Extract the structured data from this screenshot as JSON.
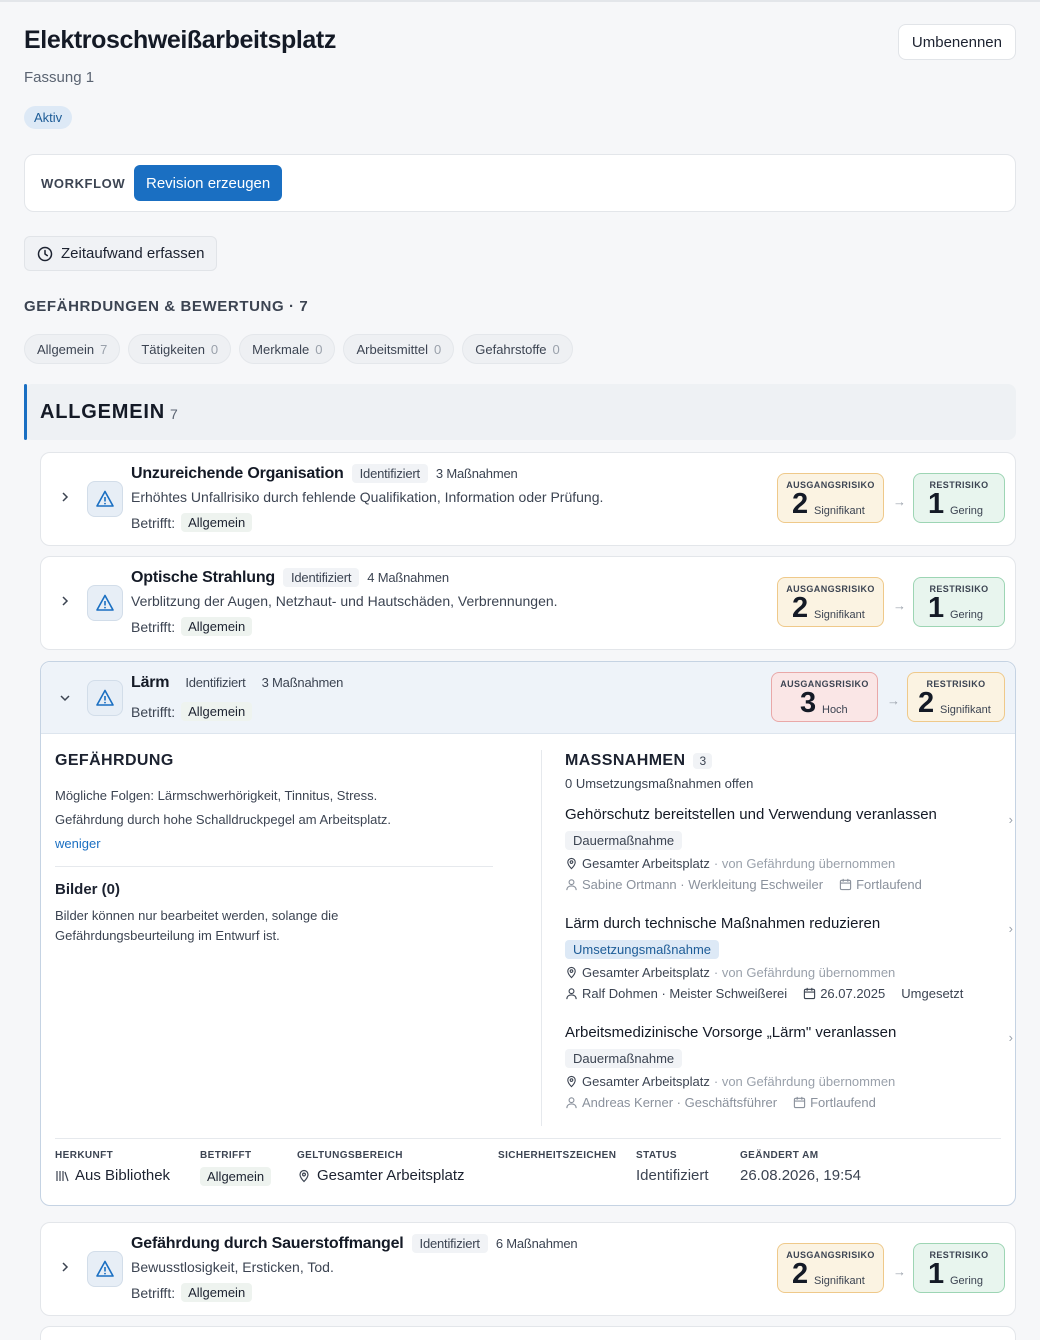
{
  "header": {
    "title": "Elektroschweißarbeitsplatz",
    "subtitle": "Fassung 1",
    "rename_label": "Umbenennen",
    "status": "Aktiv"
  },
  "workflow": {
    "label": "WORKFLOW",
    "button_label": "Revision erzeugen"
  },
  "time_button_label": "Zeitaufwand erfassen",
  "section_heading": "GEFÄHRDUNGEN & BEWERTUNG · 7",
  "filters": [
    {
      "label": "Allgemein",
      "count": "7"
    },
    {
      "label": "Tätigkeiten",
      "count": "0"
    },
    {
      "label": "Merkmale",
      "count": "0"
    },
    {
      "label": "Arbeitsmittel",
      "count": "0"
    },
    {
      "label": "Gefahrstoffe",
      "count": "0"
    }
  ],
  "group": {
    "title": "ALLGEMEIN",
    "count": "7"
  },
  "risk_labels": {
    "initial": "AUSGANGSRISIKO",
    "residual": "RESTRISIKO"
  },
  "affected_label": "Betrifft:",
  "hazards": [
    {
      "title": "Unzureichende Organisation",
      "state": "Identifiziert",
      "measures": "3 Maßnahmen",
      "description": "Erhöhtes Unfallrisiko durch fehlende Qualifikation, Information oder Prüfung.",
      "affected": "Allgemein",
      "initial_risk": {
        "value": "2",
        "label": "Signifikant"
      },
      "residual_risk": {
        "value": "1",
        "label": "Gering"
      }
    },
    {
      "title": "Optische Strahlung",
      "state": "Identifiziert",
      "measures": "4 Maßnahmen",
      "description": "Verblitzung der Augen, Netzhaut- und Hautschäden, Verbrennungen.",
      "affected": "Allgemein",
      "initial_risk": {
        "value": "2",
        "label": "Signifikant"
      },
      "residual_risk": {
        "value": "1",
        "label": "Gering"
      }
    },
    {
      "title": "Lärm",
      "state": "Identifiziert",
      "measures": "3 Maßnahmen",
      "affected": "Allgemein",
      "initial_risk": {
        "value": "3",
        "label": "Hoch"
      },
      "residual_risk": {
        "value": "2",
        "label": "Signifikant"
      }
    },
    {
      "title": "Gefährdung durch Sauerstoffmangel",
      "state": "Identifiziert",
      "measures": "6 Maßnahmen",
      "description": "Bewusstlosigkeit, Ersticken, Tod.",
      "affected": "Allgemein",
      "initial_risk": {
        "value": "2",
        "label": "Signifikant"
      },
      "residual_risk": {
        "value": "1",
        "label": "Gering"
      }
    }
  ],
  "detail": {
    "hazard_title": "GEFÄHRDUNG",
    "text1": "Mögliche Folgen: Lärmschwerhörigkeit, Tinnitus, Stress.",
    "text2": "Gefährdung durch hohe Schalldruckpegel am Arbeitsplatz.",
    "less_link": "weniger",
    "images_title": "Bilder (0)",
    "images_text": "Bilder können nur bearbeitet werden, solange die Gefährdungsbeurteilung im Entwurf ist.",
    "measures_title": "MASSNAHMEN",
    "measures_count": "3",
    "measures_open": "0 Umsetzungsmaßnahmen offen",
    "measures": [
      {
        "title": "Gehörschutz bereitstellen und Verwendung veranlassen",
        "type": "Dauermaßnahme",
        "scope": "Gesamter Arbeitsplatz",
        "origin": "· von Gefährdung übernommen",
        "person": "Sabine Ortmann · Werkleitung Eschweiler",
        "date": "Fortlaufend",
        "status": ""
      },
      {
        "title": "Lärm durch technische Maßnahmen reduzieren",
        "type": "Umsetzungsmaßnahme",
        "scope": "Gesamter Arbeitsplatz",
        "origin": "· von Gefährdung übernommen",
        "person": "Ralf Dohmen · Meister Schweißerei",
        "date": "26.07.2025",
        "status": "Umgesetzt"
      },
      {
        "title": "Arbeitsmedizinische Vorsorge „Lärm\" veranlassen",
        "type": "Dauermaßnahme",
        "scope": "Gesamter Arbeitsplatz",
        "origin": "· von Gefährdung übernommen",
        "person": "Andreas Kerner · Geschäftsführer",
        "date": "Fortlaufend",
        "status": ""
      }
    ],
    "meta": {
      "origin_label": "HERKUNFT",
      "origin_value": "Aus Bibliothek",
      "affected_label": "BETRIFFT",
      "affected_value": "Allgemein",
      "scope_label": "GELTUNGSBEREICH",
      "scope_value": "Gesamter Arbeitsplatz",
      "signs_label": "SICHERHEITSZEICHEN",
      "status_label": "STATUS",
      "status_value": "Identifiziert",
      "changed_label": "GEÄNDERT AM",
      "changed_value": "26.08.2026, 19:54"
    }
  },
  "colors": {
    "accent": "#1a6fc2",
    "risk_significant": "#fbf3e2",
    "risk_low": "#e8f5ee",
    "risk_high": "#fae6e6"
  }
}
